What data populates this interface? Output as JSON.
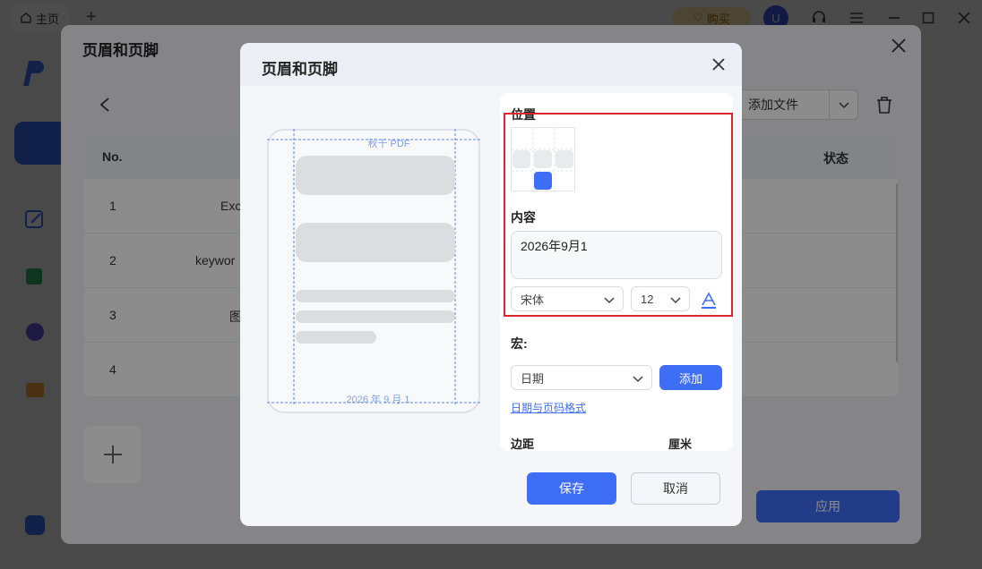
{
  "topbar": {
    "home_tab": "主页",
    "buy": "购买",
    "avatar_initial": "U"
  },
  "outer_dialog": {
    "title": "页眉和页脚",
    "add_file": "添加文件",
    "table": {
      "headers": {
        "no": "No.",
        "status": "状态"
      },
      "rows": [
        {
          "no": "1",
          "name": "Exc",
          "status": ""
        },
        {
          "no": "2",
          "name": "keywor",
          "status": ""
        },
        {
          "no": "3",
          "name": "图",
          "status": ""
        },
        {
          "no": "4",
          "name": "",
          "status": ""
        }
      ]
    },
    "apply": "应用"
  },
  "inner_dialog": {
    "title": "页眉和页脚",
    "preview": {
      "header_text": "秋千 PDF",
      "footer_text": "2026 年 9 月 1"
    },
    "position_label": "位置",
    "content_label": "内容",
    "content_value": "2026年9月1",
    "font_family": "宋体",
    "font_size": "12",
    "macro_label": "宏:",
    "macro_select": "日期",
    "add_button": "添加",
    "date_format_link": "日期与页码格式",
    "margin_label": "边距",
    "margin_unit": "厘米",
    "save": "保存",
    "cancel": "取消"
  },
  "colors": {
    "accent": "#3f6ef6",
    "highlight_border": "#d9272e"
  },
  "icons": [
    "home-icon",
    "plus-icon",
    "heart-icon",
    "headset-icon",
    "menu-icon",
    "minimize-icon",
    "maximize-icon",
    "close-icon",
    "back-icon",
    "trash-icon",
    "chevron-down-icon",
    "font-color-icon"
  ]
}
